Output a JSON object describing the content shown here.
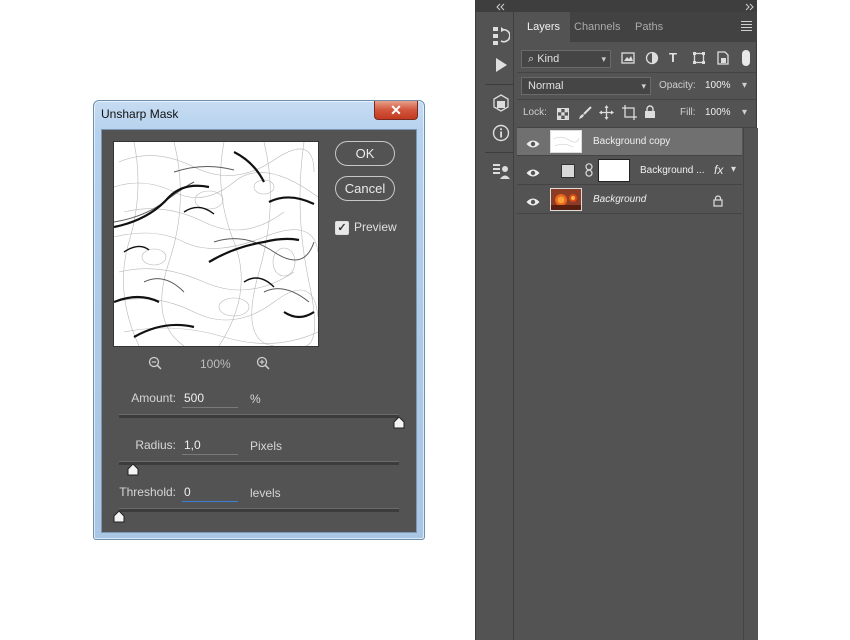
{
  "dialog": {
    "title": "Unsharp Mask",
    "close_label": "✕",
    "ok_label": "OK",
    "cancel_label": "Cancel",
    "preview_label": "Preview",
    "preview_checked": true,
    "zoom_level": "100%",
    "amount": {
      "label": "Amount:",
      "value": "500",
      "unit": "%",
      "slider_fraction": 1.0
    },
    "radius": {
      "label": "Radius:",
      "value": "1,0",
      "unit": "Pixels",
      "slider_fraction": 0.05
    },
    "threshold": {
      "label": "Threshold:",
      "value": "0",
      "unit": "levels",
      "slider_fraction": 0.0
    }
  },
  "tools": [
    "history-icon",
    "play-icon",
    "3d-icon",
    "info-icon",
    "properties-icon"
  ],
  "layers_panel": {
    "tabs": [
      {
        "label": "Layers",
        "active": true
      },
      {
        "label": "Channels",
        "active": false
      },
      {
        "label": "Paths",
        "active": false
      }
    ],
    "filter_kind": "Kind",
    "blend_mode": "Normal",
    "opacity_label": "Opacity:",
    "opacity_value": "100%",
    "lock_label": "Lock:",
    "fill_label": "Fill:",
    "fill_value": "100%",
    "layers": [
      {
        "name": "Background copy",
        "selected": true
      },
      {
        "name": "Background ...",
        "selected": false,
        "fx": "fx"
      },
      {
        "name": "Background",
        "selected": false,
        "locked": true
      }
    ]
  },
  "colors": {
    "panel": "#535353",
    "dialog_frame": "#b7d2ee",
    "close_red": "#c23a22",
    "focus_blue": "#3e7fd6"
  }
}
